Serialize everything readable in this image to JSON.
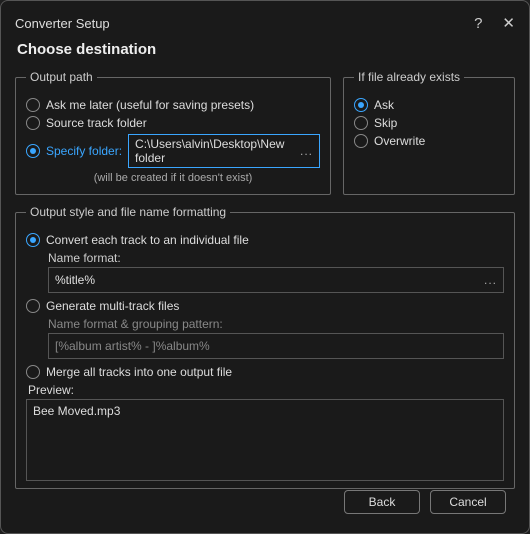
{
  "titlebar": {
    "title": "Converter Setup",
    "help_icon": "?",
    "close_icon": "✕"
  },
  "heading": "Choose destination",
  "output_path": {
    "legend": "Output path",
    "ask_later": "Ask me later (useful for saving presets)",
    "source_folder": "Source track folder",
    "specify_label": "Specify folder:",
    "folder_value": "C:\\Users\\alvin\\Desktop\\New folder",
    "folder_more": "...",
    "hint": "(will be created if it doesn't exist)"
  },
  "exists": {
    "legend": "If file already exists",
    "ask": "Ask",
    "skip": "Skip",
    "overwrite": "Overwrite"
  },
  "format": {
    "legend": "Output style and file name formatting",
    "individual": "Convert each track to an individual file",
    "name_format_label": "Name format:",
    "name_format_value": "%title%",
    "name_format_more": "...",
    "multi": "Generate multi-track files",
    "grouping_label": "Name format & grouping pattern:",
    "grouping_value": "[%album artist% - ]%album%",
    "merge": "Merge all tracks into one output file",
    "preview_label": "Preview:",
    "preview_value": "Bee Moved.mp3"
  },
  "footer": {
    "back": "Back",
    "cancel": "Cancel"
  }
}
